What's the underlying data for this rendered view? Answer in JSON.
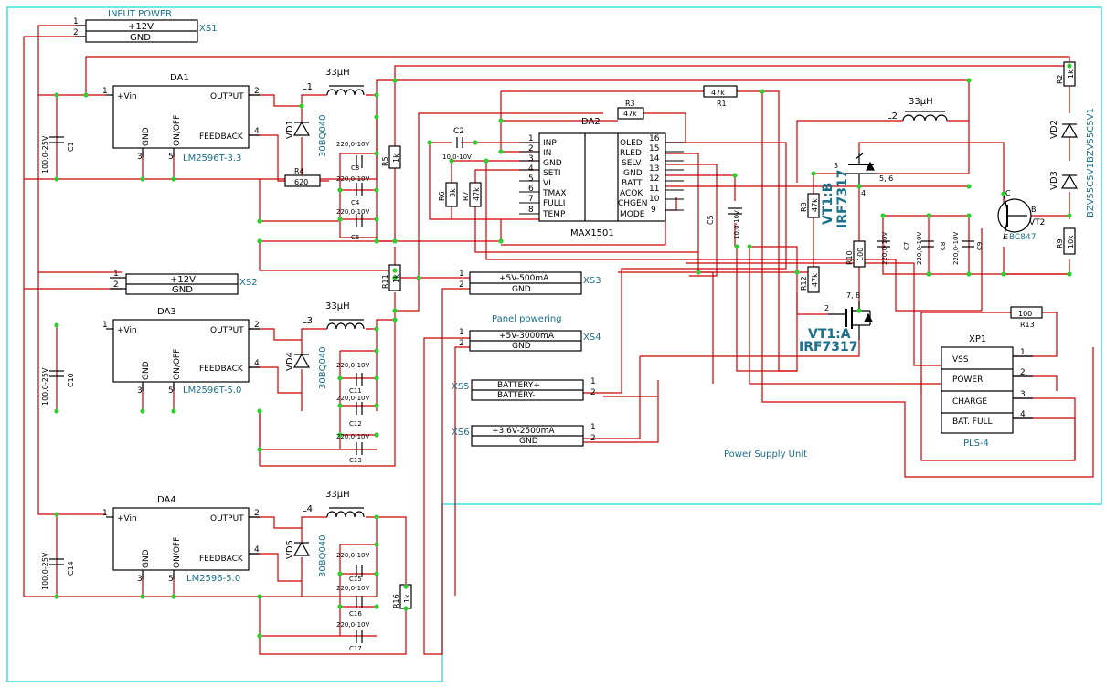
{
  "title": "Power Supply Unit",
  "panel_label": "Panel powering",
  "input_label": "INPUT POWER",
  "colors": {
    "wire": "#cc0000",
    "node": "#33cc33",
    "border": "#44dddd",
    "part": "#000000",
    "text_part": "#1a6f8a"
  },
  "connectors": {
    "xs1": {
      "name": "XS1",
      "pins": [
        "1",
        "2"
      ],
      "lines": [
        "+12V",
        "GND"
      ]
    },
    "xs2": {
      "name": "XS2",
      "pins": [
        "1",
        "2"
      ],
      "lines": [
        "+12V",
        "GND"
      ]
    },
    "xs3": {
      "name": "XS3",
      "pins": [
        "1",
        "2"
      ],
      "lines": [
        "+5V-500mA",
        "GND"
      ]
    },
    "xs4": {
      "name": "XS4",
      "pins": [
        "1",
        "2"
      ],
      "lines": [
        "+5V-3000mA",
        "GND"
      ]
    },
    "xs5": {
      "name": "XS5",
      "pins": [
        "1",
        "2"
      ],
      "lines": [
        "BATTERY+",
        "BATTERY-"
      ]
    },
    "xs6": {
      "name": "XS6",
      "pins": [
        "1",
        "2"
      ],
      "lines": [
        "+3,6V-2500mA",
        "GND"
      ]
    }
  },
  "regulators": {
    "da1": {
      "ref": "DA1",
      "part": "LM2596T-3.3",
      "pins": [
        "+Vin",
        "OUTPUT",
        "GND",
        "ON/OFF",
        "FEEDBACK"
      ],
      "nums": [
        "1",
        "2",
        "3",
        "5",
        "4"
      ]
    },
    "da3": {
      "ref": "DA3",
      "part": "LM2596T-5.0",
      "pins": [
        "+Vin",
        "OUTPUT",
        "GND",
        "ON/OFF",
        "FEEDBACK"
      ],
      "nums": [
        "1",
        "2",
        "3",
        "5",
        "4"
      ]
    },
    "da4": {
      "ref": "DA4",
      "part": "LM2596-5.0",
      "pins": [
        "+Vin",
        "OUTPUT",
        "GND",
        "ON/OFF",
        "FEEDBACK"
      ],
      "nums": [
        "1",
        "2",
        "3",
        "5",
        "4"
      ]
    }
  },
  "da2": {
    "ref": "DA2",
    "part": "MAX1501",
    "left_pins": [
      "INP",
      "IN",
      "GND",
      "SETI",
      "VL",
      "TMAX",
      "FULLI",
      "TEMP"
    ],
    "left_nums": [
      "1",
      "2",
      "3",
      "4",
      "5",
      "6",
      "7",
      "8"
    ],
    "right_pins": [
      "OLED",
      "RLED",
      "SELV",
      "GND",
      "BATT",
      "ACOK",
      "CHGEN",
      "MODE"
    ],
    "right_nums": [
      "16",
      "15",
      "14",
      "13",
      "12",
      "11",
      "10",
      "9"
    ]
  },
  "xp1": {
    "ref": "XP1",
    "part": "PLS-4",
    "pins": [
      "VSS",
      "POWER",
      "CHARGE",
      "BAT. FULL"
    ],
    "nums": [
      "1",
      "2",
      "3",
      "4"
    ]
  },
  "components": {
    "l1": "L1",
    "l3": "L3",
    "l4": "L4",
    "l2": "L2",
    "l_val": "33µH",
    "vd1": "VD1",
    "vd4": "VD4",
    "vd5": "VD5",
    "d_part": "30BQ040",
    "vd2": "VD2",
    "vd3": "VD3",
    "z_part": "BZV55C5V1",
    "c1": "C1",
    "c10": "C10",
    "c14": "C14",
    "c_in": "100,0-25V",
    "c3": "C3",
    "c4": "C4",
    "c6": "C6",
    "c11": "C11",
    "c12": "C12",
    "c13": "C13",
    "c15": "C15",
    "c16": "C16",
    "c17": "C17",
    "c_out": "220,0-10V",
    "c2": "C2",
    "c2v": "10,0-10V",
    "c5": "C5",
    "c5v": "10,0-10V",
    "c7": "C7",
    "c8": "C8",
    "c9": "C9",
    "c_batt": "220,0-10V",
    "r1": "R1",
    "r1v": "47k",
    "r2": "R2",
    "r2v": "1k",
    "r3": "R3",
    "r3v": "47k",
    "r4": "R4",
    "r4v": "620",
    "r5": "R5",
    "r5v": "1k",
    "r6": "R6",
    "r6v": "3k",
    "r7": "R7",
    "r7v": "47k",
    "r8": "R8",
    "r8v": "47k",
    "r9": "R9",
    "r9v": "10k",
    "r10": "R10",
    "r10v": "100",
    "r11": "R11",
    "r11v": "1k",
    "r12": "R12",
    "r12v": "47k",
    "r13": "R13",
    "r13v": "100",
    "r16": "R16",
    "r16v": "1k",
    "vt1b": "VT1:B",
    "vt1a": "VT1:A",
    "vt_part": "IRF7317",
    "vt2": "VT2",
    "vt2_part": "BC847",
    "vt1b_pins": [
      "3",
      "4",
      "5, 6"
    ],
    "vt1a_pins": [
      "2",
      "7, 8"
    ],
    "vt2_pins": [
      "C",
      "B",
      "E"
    ]
  }
}
